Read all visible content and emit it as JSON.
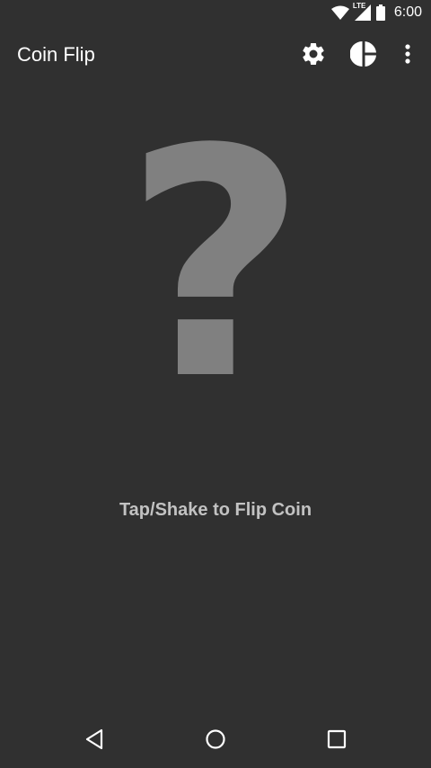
{
  "status_bar": {
    "time": "6:00",
    "network_badge": "LTE",
    "icons": [
      "wifi-icon",
      "signal-icon",
      "battery-icon"
    ]
  },
  "app_bar": {
    "title": "Coin Flip",
    "actions": [
      "gear-icon",
      "pie-chart-icon",
      "overflow-menu-icon"
    ]
  },
  "main": {
    "coin_glyph": "?",
    "hint": "Tap/Shake to Flip Coin"
  },
  "nav_bar": {
    "buttons": [
      "back-icon",
      "home-icon",
      "recents-icon"
    ]
  },
  "colors": {
    "background": "#303030",
    "glyph": "#808080",
    "hint_text": "#c2c2c2",
    "title_text": "#ffffff"
  }
}
